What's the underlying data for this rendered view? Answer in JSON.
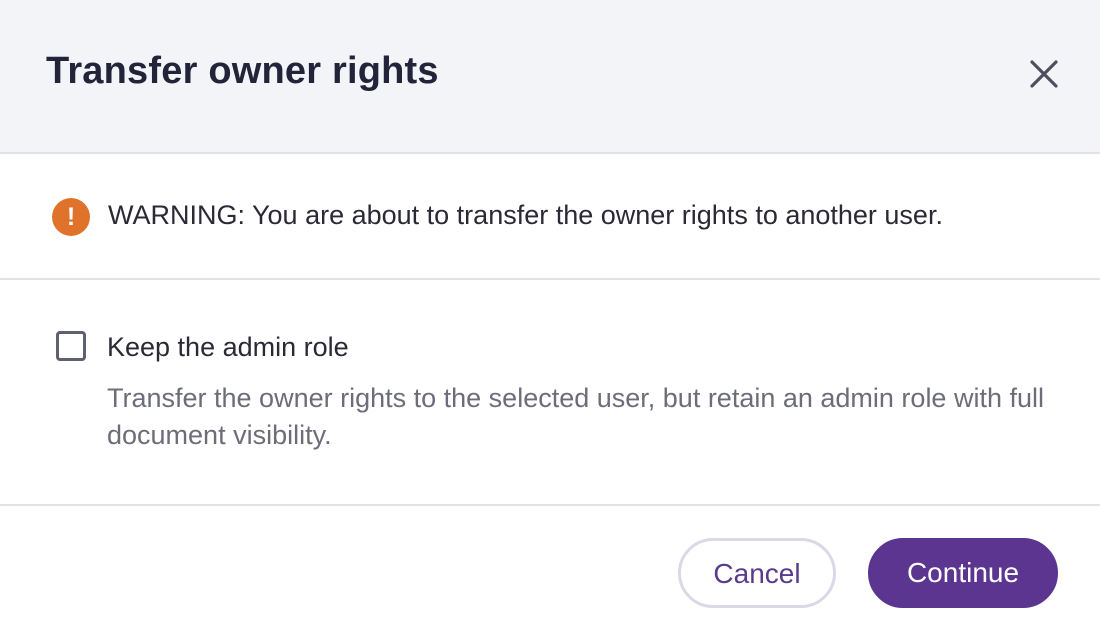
{
  "dialog": {
    "title": "Transfer owner rights",
    "close_icon": "close-icon"
  },
  "warning": {
    "icon": "exclamation-icon",
    "icon_glyph": "!",
    "text": "WARNING: You are about to transfer the owner rights to another user.",
    "icon_color": "#e0732b"
  },
  "option": {
    "checked": false,
    "label": "Keep the admin role",
    "description": "Transfer the owner rights to the selected user, but retain an admin role with full document visibility."
  },
  "footer": {
    "cancel_label": "Cancel",
    "continue_label": "Continue",
    "accent_color": "#5b3590"
  }
}
